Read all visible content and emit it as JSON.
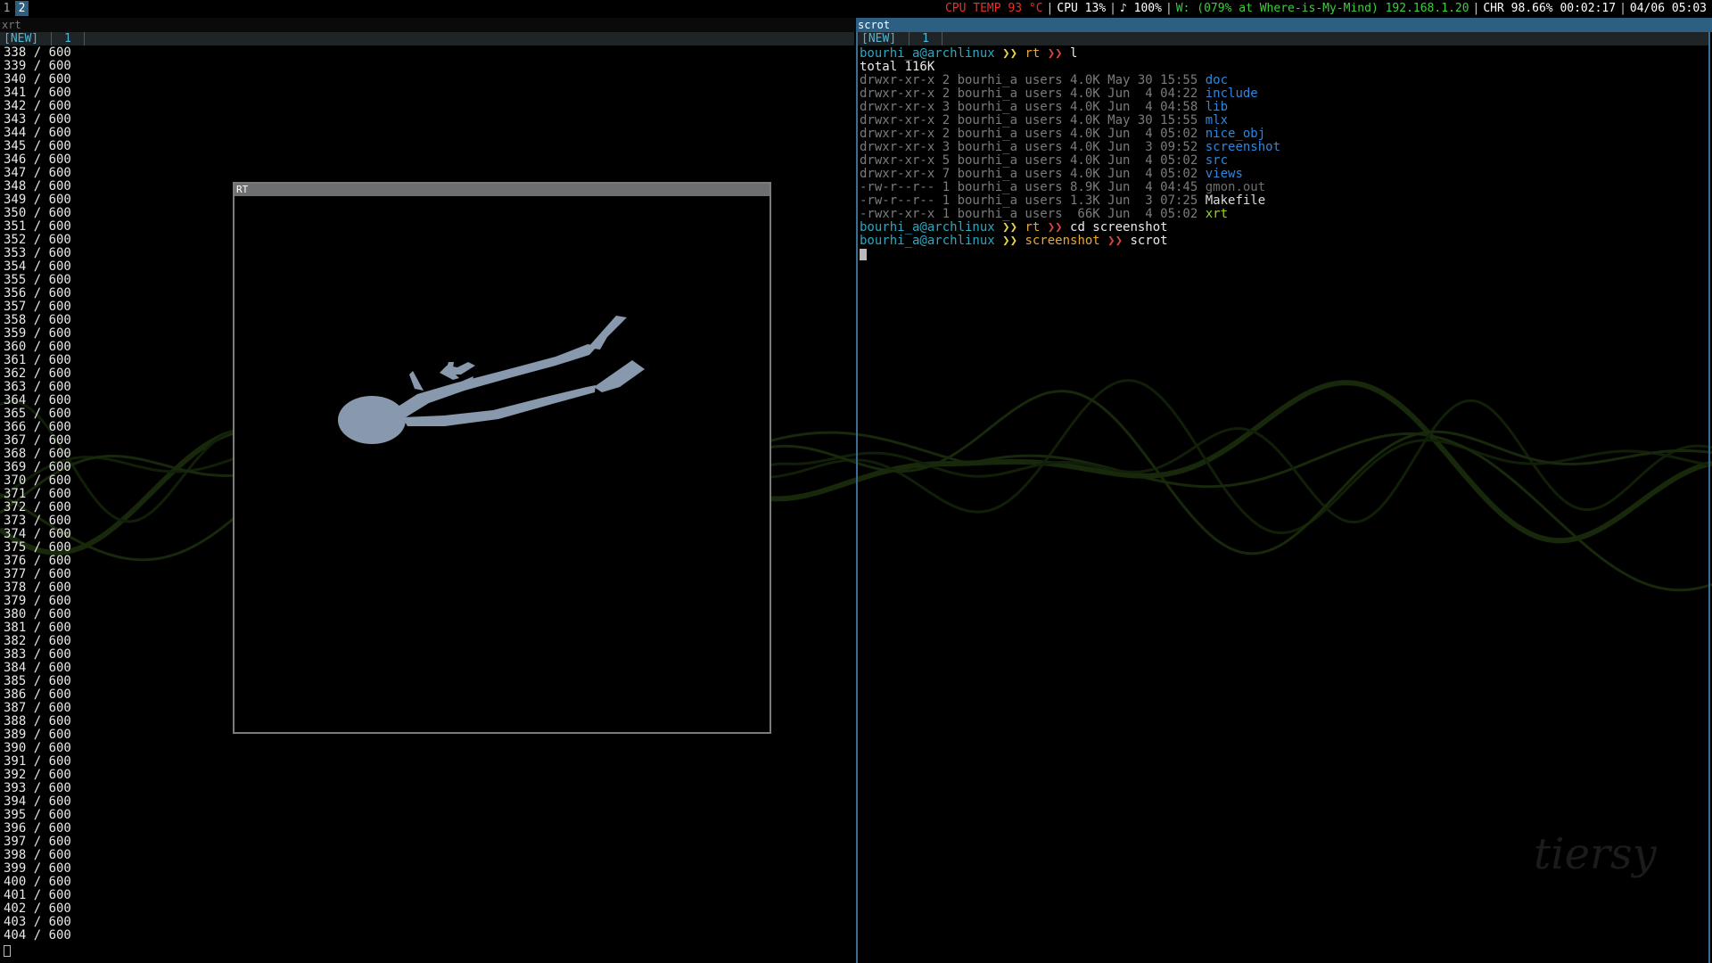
{
  "topbar": {
    "workspaces": [
      {
        "label": "1",
        "active": false
      },
      {
        "label": "2",
        "active": true
      }
    ],
    "status": {
      "cpu_temp": "CPU TEMP 93 °C",
      "cpu": "CPU 13%",
      "volume": "♪ 100%",
      "wifi": "W: (079% at Where-is-My-Mind) 192.168.1.20",
      "battery": "CHR 98.66% 00:02:17",
      "datetime": "04/06 05:03"
    },
    "colors": {
      "cpu_temp": "#e8302a",
      "wifi": "#3ccf3c",
      "text": "#ffffff"
    }
  },
  "left_pane": {
    "title": "xrt",
    "tab_new": "[NEW]",
    "tab_num": "1",
    "counter_start": 338,
    "counter_end": 404,
    "counter_total": "600"
  },
  "rt_window": {
    "title": "RT",
    "figure_color": "#8898ad"
  },
  "right_pane": {
    "title": "scrot",
    "tab_new": "[NEW]",
    "tab_num": "1",
    "prompt_user": "bourhi_a@archlinux",
    "prompt_sep": "❯❯",
    "lines": [
      {
        "kind": "prompt",
        "dir": "rt",
        "cmd": "l"
      },
      {
        "kind": "text",
        "text": "total 116K"
      },
      {
        "kind": "ls",
        "perm": "drwxr-xr-x 2 bourhi_a users 4.0K May 30 15:55 ",
        "name": "doc",
        "color": "fblue"
      },
      {
        "kind": "ls",
        "perm": "drwxr-xr-x 2 bourhi_a users 4.0K Jun  4 04:22 ",
        "name": "include",
        "color": "fblue"
      },
      {
        "kind": "ls",
        "perm": "drwxr-xr-x 3 bourhi_a users 4.0K Jun  4 04:58 ",
        "name": "lib",
        "color": "fblue"
      },
      {
        "kind": "ls",
        "perm": "drwxr-xr-x 2 bourhi_a users 4.0K May 30 15:55 ",
        "name": "mlx",
        "color": "fblue"
      },
      {
        "kind": "ls",
        "perm": "drwxr-xr-x 2 bourhi_a users 4.0K Jun  4 05:02 ",
        "name": "nice_obj",
        "color": "fblue"
      },
      {
        "kind": "ls",
        "perm": "drwxr-xr-x 3 bourhi_a users 4.0K Jun  3 09:52 ",
        "name": "screenshot",
        "color": "fblue"
      },
      {
        "kind": "ls",
        "perm": "drwxr-xr-x 5 bourhi_a users 4.0K Jun  4 05:02 ",
        "name": "src",
        "color": "fblue"
      },
      {
        "kind": "ls",
        "perm": "drwxr-xr-x 7 bourhi_a users 4.0K Jun  4 05:02 ",
        "name": "views",
        "color": "fblue"
      },
      {
        "kind": "ls",
        "perm": "-rw-r--r-- 1 bourhi_a users 8.9K Jun  4 04:45 ",
        "name": "gmon.out",
        "color": "fgrey"
      },
      {
        "kind": "ls",
        "perm": "-rw-r--r-- 1 bourhi_a users 1.3K Jun  3 07:25 ",
        "name": "Makefile",
        "color": "fwhite"
      },
      {
        "kind": "ls",
        "perm": "-rwxr-xr-x 1 bourhi_a users  66K Jun  4 05:02 ",
        "name": "xrt",
        "color": "fgreen"
      },
      {
        "kind": "prompt",
        "dir": "rt",
        "cmd": "cd screenshot"
      },
      {
        "kind": "prompt",
        "dir": "screenshot",
        "cmd": "scrot"
      }
    ]
  }
}
